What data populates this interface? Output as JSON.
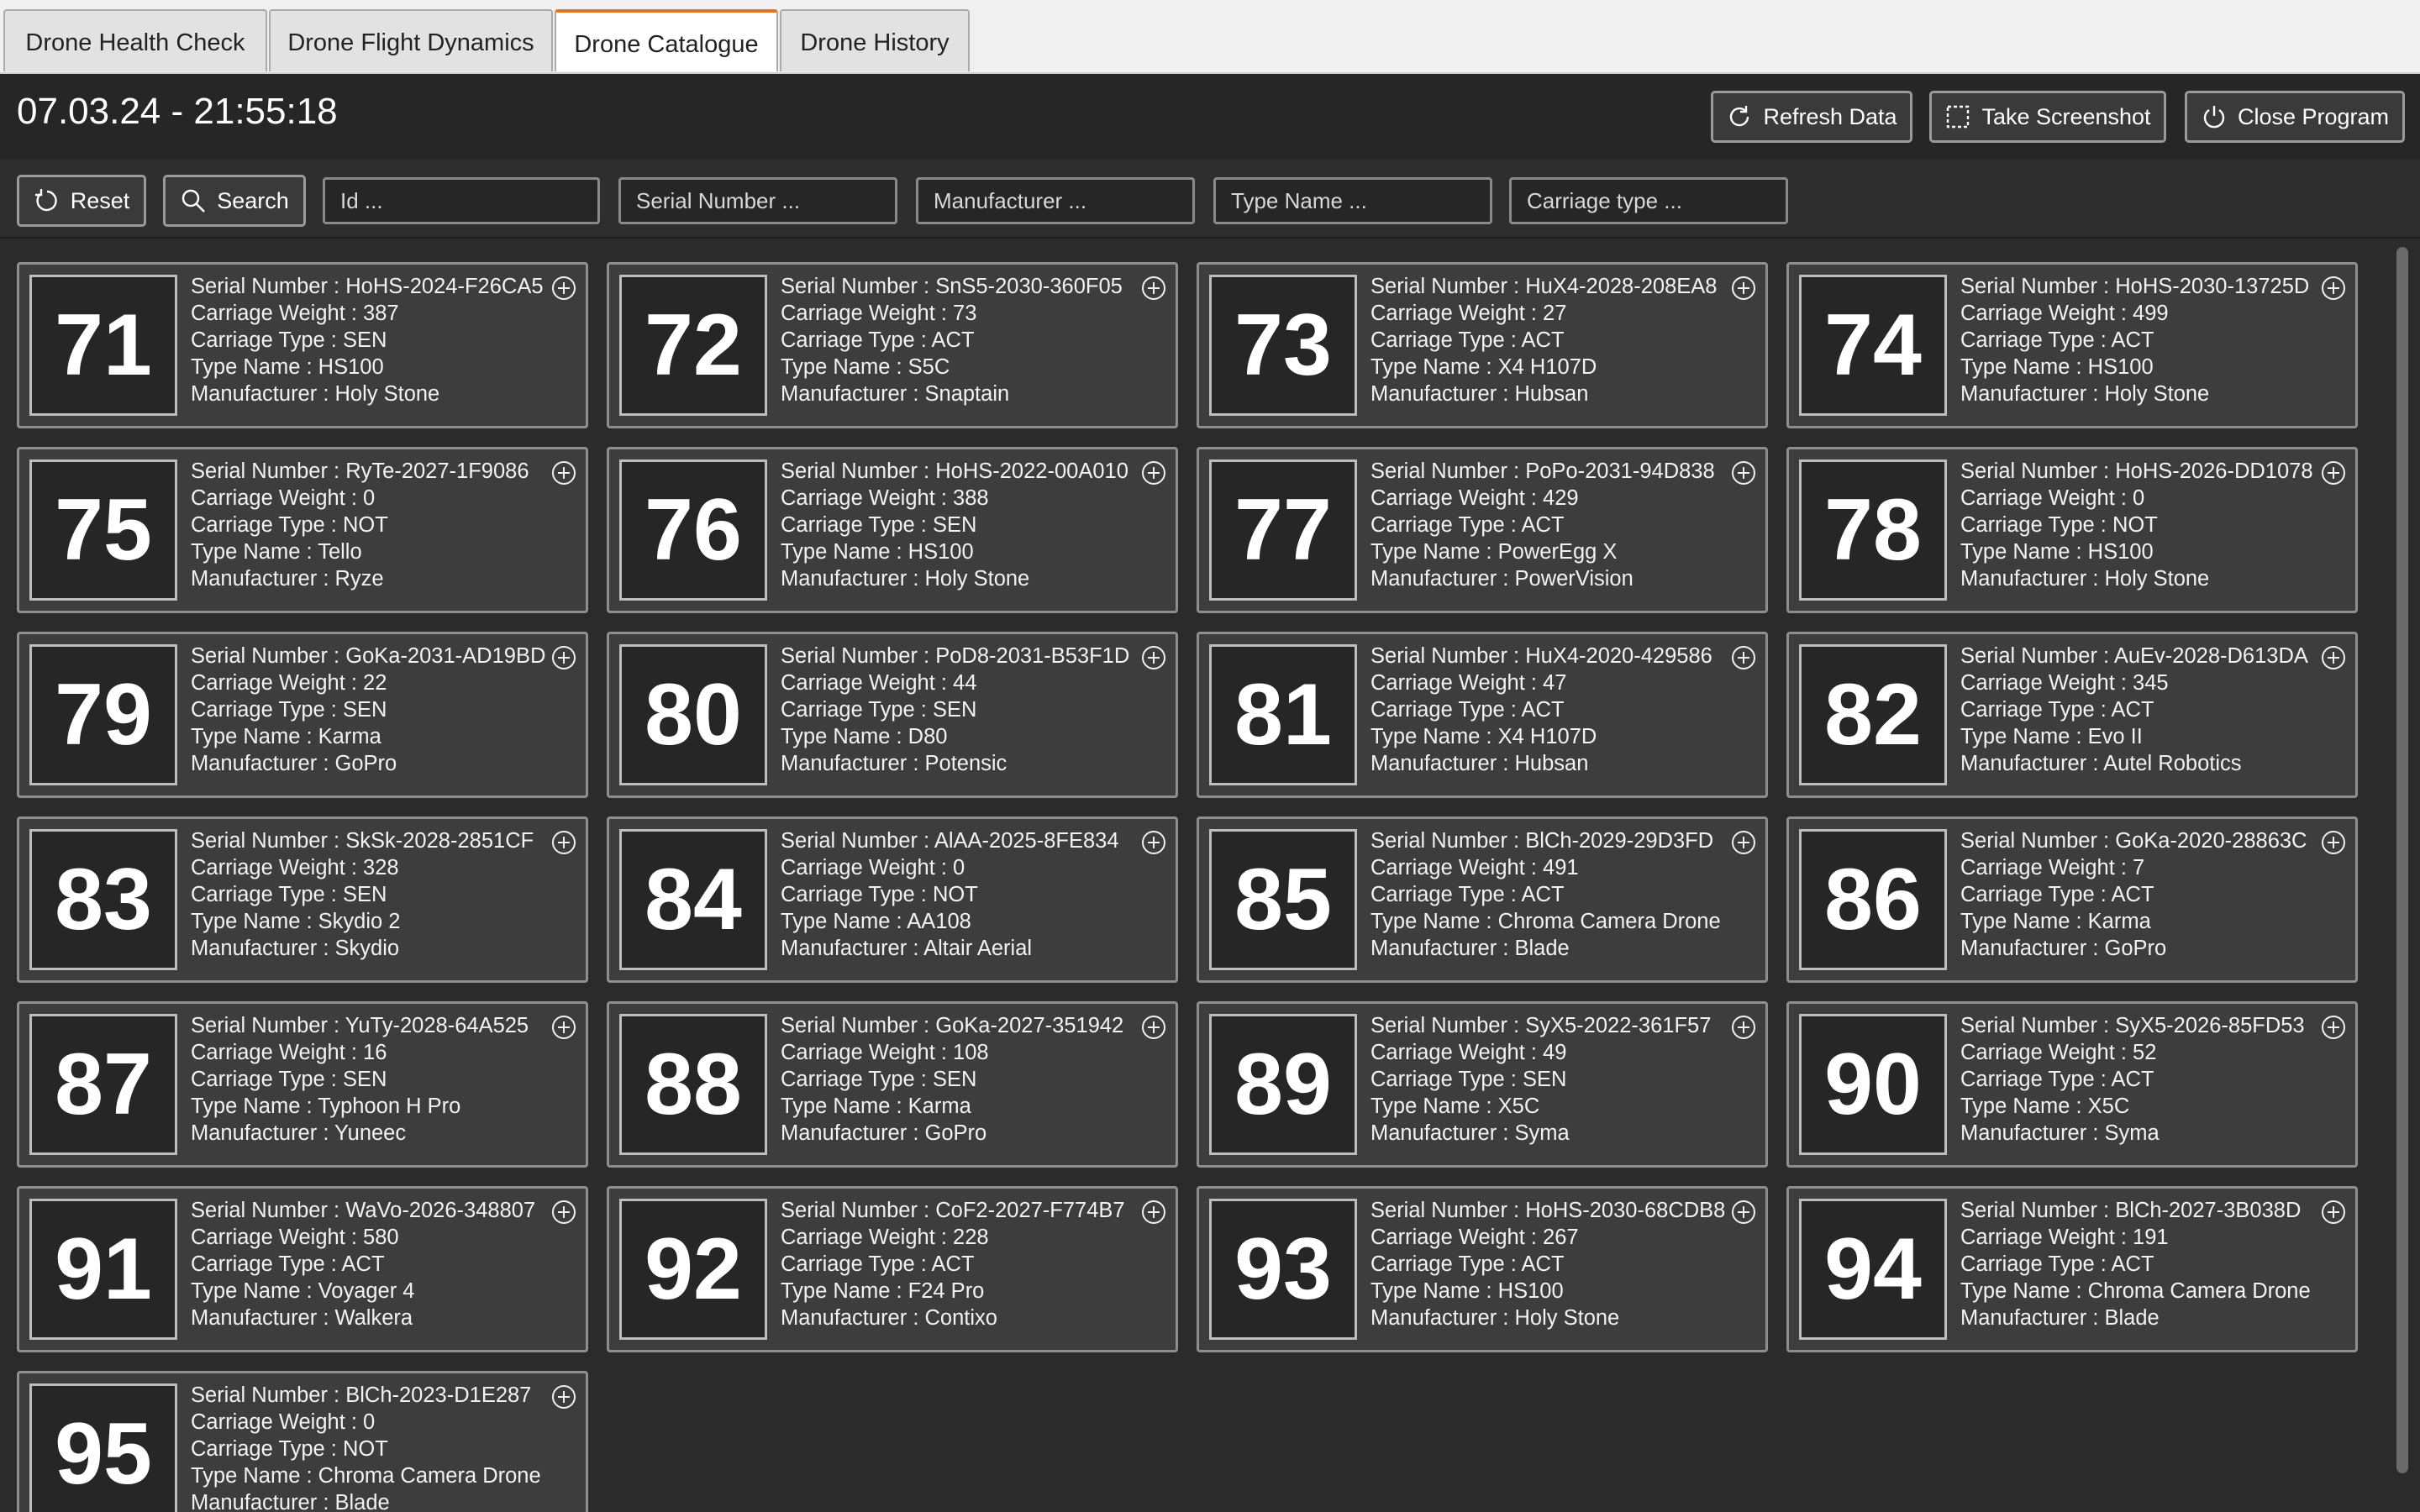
{
  "tabs": [
    {
      "label": "Drone Health Check",
      "active": false
    },
    {
      "label": "Drone Flight Dynamics",
      "active": false
    },
    {
      "label": "Drone Catalogue",
      "active": true
    },
    {
      "label": "Drone History",
      "active": false
    }
  ],
  "header": {
    "datetime": "07.03.24 - 21:55:18",
    "refresh_label": "Refresh Data",
    "screenshot_label": "Take Screenshot",
    "close_label": "Close Program"
  },
  "filters": {
    "reset_label": "Reset",
    "search_label": "Search",
    "id_placeholder": "Id ...",
    "serial_placeholder": "Serial Number ...",
    "manufacturer_placeholder": "Manufacturer ...",
    "type_name_placeholder": "Type Name ...",
    "carriage_type_placeholder": "Carriage type ..."
  },
  "field_labels": {
    "serial": "Serial Number : ",
    "weight": "Carriage Weight : ",
    "ctype": "Carriage Type : ",
    "tname": "Type Name : ",
    "manufacturer": "Manufacturer : "
  },
  "drones": [
    {
      "id": "71",
      "serial": "HoHS-2024-F26CA5",
      "weight": "387",
      "ctype": "SEN",
      "tname": "HS100",
      "manufacturer": "Holy Stone"
    },
    {
      "id": "72",
      "serial": "SnS5-2030-360F05",
      "weight": "73",
      "ctype": "ACT",
      "tname": "S5C",
      "manufacturer": "Snaptain"
    },
    {
      "id": "73",
      "serial": "HuX4-2028-208EA8",
      "weight": "27",
      "ctype": "ACT",
      "tname": "X4 H107D",
      "manufacturer": "Hubsan"
    },
    {
      "id": "74",
      "serial": "HoHS-2030-13725D",
      "weight": "499",
      "ctype": "ACT",
      "tname": "HS100",
      "manufacturer": "Holy Stone"
    },
    {
      "id": "75",
      "serial": "RyTe-2027-1F9086",
      "weight": "0",
      "ctype": "NOT",
      "tname": "Tello",
      "manufacturer": "Ryze"
    },
    {
      "id": "76",
      "serial": "HoHS-2022-00A010",
      "weight": "388",
      "ctype": "SEN",
      "tname": "HS100",
      "manufacturer": "Holy Stone"
    },
    {
      "id": "77",
      "serial": "PoPo-2031-94D838",
      "weight": "429",
      "ctype": "ACT",
      "tname": "PowerEgg X",
      "manufacturer": "PowerVision"
    },
    {
      "id": "78",
      "serial": "HoHS-2026-DD1078",
      "weight": "0",
      "ctype": "NOT",
      "tname": "HS100",
      "manufacturer": "Holy Stone"
    },
    {
      "id": "79",
      "serial": "GoKa-2031-AD19BD",
      "weight": "22",
      "ctype": "SEN",
      "tname": "Karma",
      "manufacturer": "GoPro"
    },
    {
      "id": "80",
      "serial": "PoD8-2031-B53F1D",
      "weight": "44",
      "ctype": "SEN",
      "tname": "D80",
      "manufacturer": "Potensic"
    },
    {
      "id": "81",
      "serial": "HuX4-2020-429586",
      "weight": "47",
      "ctype": "ACT",
      "tname": "X4 H107D",
      "manufacturer": "Hubsan"
    },
    {
      "id": "82",
      "serial": "AuEv-2028-D613DA",
      "weight": "345",
      "ctype": "ACT",
      "tname": "Evo II",
      "manufacturer": "Autel Robotics"
    },
    {
      "id": "83",
      "serial": "SkSk-2028-2851CF",
      "weight": "328",
      "ctype": "SEN",
      "tname": "Skydio 2",
      "manufacturer": "Skydio"
    },
    {
      "id": "84",
      "serial": "AlAA-2025-8FE834",
      "weight": "0",
      "ctype": "NOT",
      "tname": "AA108",
      "manufacturer": "Altair Aerial"
    },
    {
      "id": "85",
      "serial": "BlCh-2029-29D3FD",
      "weight": "491",
      "ctype": "ACT",
      "tname": "Chroma Camera Drone",
      "manufacturer": "Blade"
    },
    {
      "id": "86",
      "serial": "GoKa-2020-28863C",
      "weight": "7",
      "ctype": "ACT",
      "tname": "Karma",
      "manufacturer": "GoPro"
    },
    {
      "id": "87",
      "serial": "YuTy-2028-64A525",
      "weight": "16",
      "ctype": "SEN",
      "tname": "Typhoon H Pro",
      "manufacturer": "Yuneec"
    },
    {
      "id": "88",
      "serial": "GoKa-2027-351942",
      "weight": "108",
      "ctype": "SEN",
      "tname": "Karma",
      "manufacturer": "GoPro"
    },
    {
      "id": "89",
      "serial": "SyX5-2022-361F57",
      "weight": "49",
      "ctype": "SEN",
      "tname": "X5C",
      "manufacturer": "Syma"
    },
    {
      "id": "90",
      "serial": "SyX5-2026-85FD53",
      "weight": "52",
      "ctype": "ACT",
      "tname": "X5C",
      "manufacturer": "Syma"
    },
    {
      "id": "91",
      "serial": "WaVo-2026-348807",
      "weight": "580",
      "ctype": "ACT",
      "tname": "Voyager 4",
      "manufacturer": "Walkera"
    },
    {
      "id": "92",
      "serial": "CoF2-2027-F774B7",
      "weight": "228",
      "ctype": "ACT",
      "tname": "F24 Pro",
      "manufacturer": "Contixo"
    },
    {
      "id": "93",
      "serial": "HoHS-2030-68CDB8",
      "weight": "267",
      "ctype": "ACT",
      "tname": "HS100",
      "manufacturer": "Holy Stone"
    },
    {
      "id": "94",
      "serial": "BlCh-2027-3B038D",
      "weight": "191",
      "ctype": "ACT",
      "tname": "Chroma Camera Drone",
      "manufacturer": "Blade"
    },
    {
      "id": "95",
      "serial": "BlCh-2023-D1E287",
      "weight": "0",
      "ctype": "NOT",
      "tname": "Chroma Camera Drone",
      "manufacturer": "Blade"
    }
  ],
  "colors": {
    "accent": "#e8731e",
    "background": "#2b2b2b",
    "card": "#3d3d3d"
  }
}
